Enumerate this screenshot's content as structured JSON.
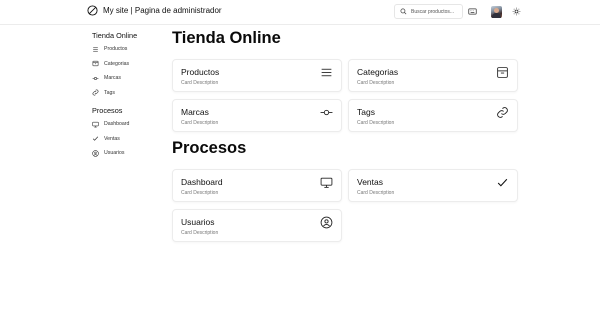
{
  "header": {
    "logo_icon": "slash-circle-icon",
    "title": "My site | Pagina de administrador",
    "search": {
      "placeholder": "Buscar productos...",
      "icon": "search-icon"
    },
    "keyboard_icon": "keyboard-icon",
    "avatar": "user-avatar",
    "theme_icon": "sun-icon"
  },
  "sidebar": {
    "groups": [
      {
        "heading": "Tienda Online",
        "items": [
          {
            "label": "Productos",
            "icon": "menu-lines-icon"
          },
          {
            "label": "Categorias",
            "icon": "archive-box-icon"
          },
          {
            "label": "Marcas",
            "icon": "commit-icon"
          },
          {
            "label": "Tags",
            "icon": "link-icon"
          }
        ]
      },
      {
        "heading": "Procesos",
        "items": [
          {
            "label": "Dashboard",
            "icon": "monitor-icon"
          },
          {
            "label": "Ventas",
            "icon": "check-icon"
          },
          {
            "label": "Usuarios",
            "icon": "user-circle-icon"
          }
        ]
      }
    ]
  },
  "main": {
    "sections": [
      {
        "title": "Tienda Online",
        "cards": [
          {
            "title": "Productos",
            "description": "Card Description",
            "icon": "menu-lines-icon"
          },
          {
            "title": "Categorias",
            "description": "Card Description",
            "icon": "archive-box-icon"
          },
          {
            "title": "Marcas",
            "description": "Card Description",
            "icon": "commit-icon"
          },
          {
            "title": "Tags",
            "description": "Card Description",
            "icon": "link-icon"
          }
        ]
      },
      {
        "title": "Procesos",
        "cards": [
          {
            "title": "Dashboard",
            "description": "Card Description",
            "icon": "monitor-icon"
          },
          {
            "title": "Ventas",
            "description": "Card Description",
            "icon": "check-icon"
          },
          {
            "title": "Usuarios",
            "description": "Card Description",
            "icon": "user-circle-icon"
          }
        ]
      }
    ]
  }
}
